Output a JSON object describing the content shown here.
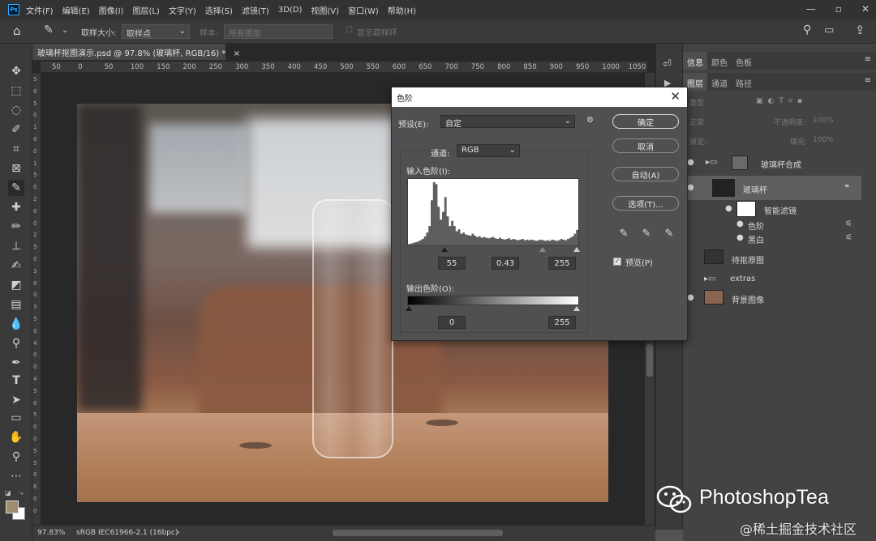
{
  "app": {
    "logo": "Ps"
  },
  "menu": [
    "文件(F)",
    "编辑(E)",
    "图像(I)",
    "图层(L)",
    "文字(Y)",
    "选择(S)",
    "滤镜(T)",
    "3D(D)",
    "视图(V)",
    "窗口(W)",
    "帮助(H)"
  ],
  "window_controls": {
    "minimize": "—",
    "maximize": "▫",
    "close": "✕"
  },
  "options": {
    "sample_size_label": "取样大小:",
    "sample_size_value": "取样点",
    "sample_label": "样本:",
    "sample_value": "所有图层",
    "show_ring": "显示取样环"
  },
  "tools": [
    "move-tool-icon",
    "marquee-tool-icon",
    "lasso-tool-icon",
    "quick-select-icon",
    "crop-tool-icon",
    "frame-tool-icon",
    "eyedropper-tool-icon",
    "healing-brush-icon",
    "brush-tool-icon",
    "clone-stamp-icon",
    "history-brush-icon",
    "eraser-tool-icon",
    "gradient-tool-icon",
    "blur-tool-icon",
    "dodge-tool-icon",
    "pen-tool-icon",
    "type-tool-icon",
    "path-select-icon",
    "rectangle-tool-icon",
    "hand-tool-icon",
    "zoom-tool-icon",
    "more-tools-icon"
  ],
  "document": {
    "tab_title": "玻璃杯抠图演示.psd @ 97.8% (玻璃杯, RGB/16) *",
    "tab_close": "×"
  },
  "ruler": {
    "top": [
      "50",
      "0",
      "50",
      "100",
      "150",
      "200",
      "250",
      "300",
      "350",
      "400",
      "450",
      "500",
      "550",
      "600",
      "650",
      "700",
      "750",
      "800",
      "850",
      "900",
      "950",
      "1000",
      "1050"
    ],
    "left": [
      "5",
      "0",
      "5",
      "0",
      "1",
      "0",
      "0",
      "1",
      "5",
      "0",
      "2",
      "0",
      "0",
      "2",
      "5",
      "0",
      "3",
      "0",
      "0",
      "3",
      "5",
      "0",
      "4",
      "0",
      "0",
      "4",
      "5",
      "0",
      "5",
      "0",
      "0",
      "5",
      "5",
      "0",
      "6",
      "0",
      "0"
    ]
  },
  "status": {
    "zoom": "97.83%",
    "profile": "sRGB IEC61966-2.1 (16bpc)",
    "arrow": "›"
  },
  "panels": {
    "top_tabs": [
      "信息",
      "颜色",
      "色板"
    ],
    "layer_tabs": [
      "图层",
      "通道",
      "路径"
    ],
    "filter_kind": "类型",
    "blend_mode": "正常",
    "opacity_label": "不透明度:",
    "opacity_value": "100%",
    "lock_label": "锁定:",
    "fill_label": "填充:",
    "fill_value": "100%",
    "layers": [
      {
        "name": "玻璃杯合成",
        "type": "group"
      },
      {
        "name": "玻璃杯",
        "type": "smart",
        "selected": true
      },
      {
        "name": "智能滤镜",
        "type": "filter-mask"
      },
      {
        "name": "色阶",
        "type": "filter"
      },
      {
        "name": "黑白",
        "type": "filter"
      },
      {
        "name": "待抠原图",
        "type": "image"
      },
      {
        "name": "extras",
        "type": "group"
      },
      {
        "name": "背景图像",
        "type": "image"
      }
    ]
  },
  "levels": {
    "title": "色阶",
    "close": "✕",
    "preset_label": "预设(E):",
    "preset_value": "自定",
    "channel_label": "通道:",
    "channel_value": "RGB",
    "input_label": "输入色阶(I):",
    "input_black": "55",
    "input_gamma": "0.43",
    "input_white": "255",
    "output_label": "输出色阶(O):",
    "output_black": "0",
    "output_white": "255",
    "buttons": {
      "ok": "确定",
      "cancel": "取消",
      "auto": "自动(A)",
      "options": "选项(T)..."
    },
    "preview_label": "预览(P)",
    "preview_checked": true,
    "histogram": [
      2,
      3,
      4,
      5,
      6,
      8,
      10,
      14,
      20,
      30,
      70,
      98,
      95,
      60,
      40,
      52,
      75,
      45,
      30,
      38,
      30,
      22,
      25,
      18,
      20,
      17,
      16,
      15,
      18,
      15,
      13,
      14,
      12,
      13,
      12,
      11,
      12,
      13,
      11,
      10,
      12,
      10,
      9,
      10,
      11,
      9,
      10,
      9,
      8,
      9,
      10,
      8,
      9,
      8,
      9,
      8,
      7,
      8,
      9,
      8,
      7,
      8,
      7,
      9,
      8,
      7,
      8,
      10,
      9,
      8,
      10,
      12,
      14,
      18,
      24
    ]
  },
  "watermark": {
    "brand": "PhotoshopTea",
    "site": "@稀土掘金技术社区"
  },
  "colors": {
    "accent_ps": "#31a8ff",
    "foreground": "#a08c6c",
    "background": "#ffffff"
  }
}
